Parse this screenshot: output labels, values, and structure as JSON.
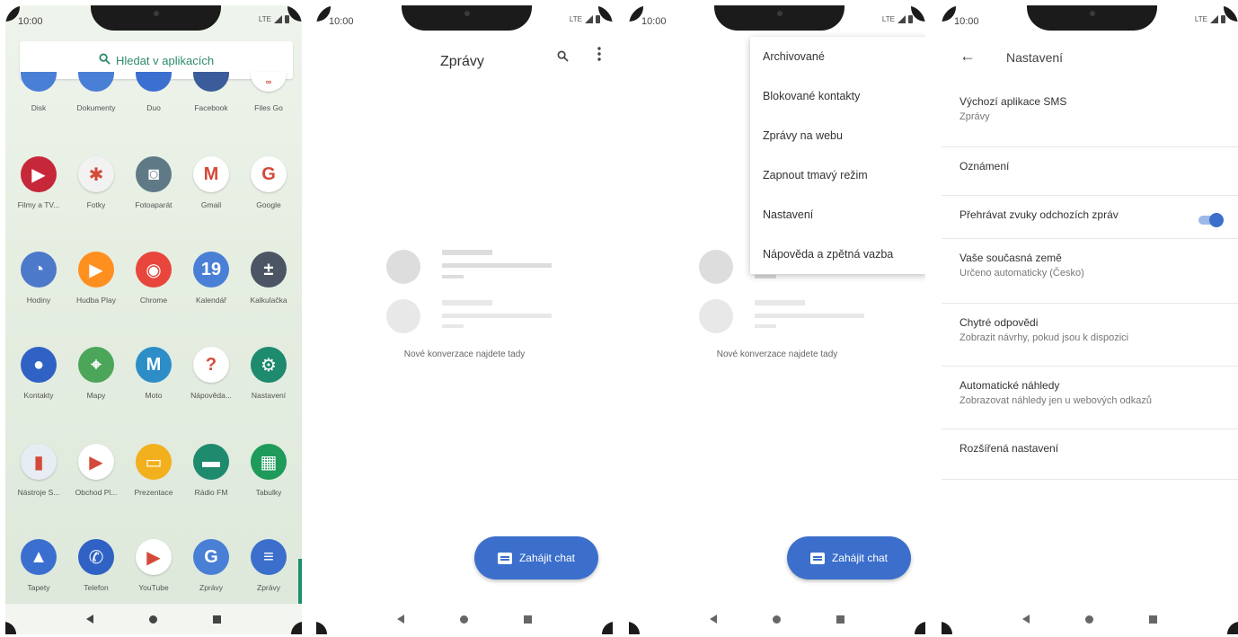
{
  "status": {
    "time": "10:00",
    "network": "LTE"
  },
  "drawer": {
    "search_label": "Hledat v aplikacích",
    "rows": [
      [
        {
          "label": "Disk",
          "color": "#4a7fd6",
          "glyph": ""
        },
        {
          "label": "Dokumenty",
          "color": "#4a7fd6",
          "glyph": ""
        },
        {
          "label": "Duo",
          "color": "#3b6fd0",
          "glyph": ""
        },
        {
          "label": "Facebook",
          "color": "#3b5c9a",
          "glyph": ""
        },
        {
          "label": "Files Go",
          "color": "#ffffff",
          "glyph": "∞"
        }
      ],
      [
        {
          "label": "Filmy a TV...",
          "color": "#c62839",
          "glyph": "▶"
        },
        {
          "label": "Fotky",
          "color": "#f2f2f2",
          "glyph": "✱"
        },
        {
          "label": "Fotoaparát",
          "color": "#5f7a86",
          "glyph": "◙"
        },
        {
          "label": "Gmail",
          "color": "#ffffff",
          "glyph": "M"
        },
        {
          "label": "Google",
          "color": "#ffffff",
          "glyph": "G"
        }
      ],
      [
        {
          "label": "Hodiny",
          "color": "#4c79c9",
          "glyph": "◔"
        },
        {
          "label": "Hudba Play",
          "color": "#ff8f1f",
          "glyph": "▶"
        },
        {
          "label": "Chrome",
          "color": "#e8453c",
          "glyph": "◉"
        },
        {
          "label": "Kalendář",
          "color": "#4a7fd6",
          "glyph": "19"
        },
        {
          "label": "Kalkulačka",
          "color": "#4b5563",
          "glyph": "±"
        }
      ],
      [
        {
          "label": "Kontakty",
          "color": "#2f62c4",
          "glyph": "●"
        },
        {
          "label": "Mapy",
          "color": "#4ca65a",
          "glyph": "⌖"
        },
        {
          "label": "Moto",
          "color": "#2d8ec7",
          "glyph": "M"
        },
        {
          "label": "Nápověda...",
          "color": "#ffffff",
          "glyph": "?"
        },
        {
          "label": "Nastavení",
          "color": "#1e8a6e",
          "glyph": "⚙"
        }
      ],
      [
        {
          "label": "Nástroje S...",
          "color": "#e8ecf3",
          "glyph": "▮"
        },
        {
          "label": "Obchod Pl...",
          "color": "#ffffff",
          "glyph": "▶"
        },
        {
          "label": "Prezentace",
          "color": "#f2b01e",
          "glyph": "▭"
        },
        {
          "label": "Rádio FM",
          "color": "#1e8a6e",
          "glyph": "▬"
        },
        {
          "label": "Tabulky",
          "color": "#1e9a5a",
          "glyph": "▦"
        }
      ],
      [
        {
          "label": "Tapety",
          "color": "#3a6fd0",
          "glyph": "▲"
        },
        {
          "label": "Telefon",
          "color": "#2f62c4",
          "glyph": "✆"
        },
        {
          "label": "YouTube",
          "color": "#ffffff",
          "glyph": "▶"
        },
        {
          "label": "Zprávy",
          "color": "#4a7fd6",
          "glyph": "G"
        },
        {
          "label": "Zprávy",
          "color": "#3c6fcc",
          "glyph": "≡"
        }
      ]
    ]
  },
  "messages": {
    "title": "Zprávy",
    "empty_text": "Nové konverzace najdete tady",
    "fab_label": "Zahájit chat"
  },
  "overflow_menu": {
    "items": [
      "Archivované",
      "Blokované kontakty",
      "Zprávy na webu",
      "Zapnout tmavý režim",
      "Nastavení",
      "Nápověda a zpětná vazba"
    ]
  },
  "settings": {
    "title": "Nastavení",
    "items": [
      {
        "title": "Výchozí aplikace SMS",
        "subtitle": "Zprávy"
      },
      {
        "title": "Oznámení",
        "subtitle": ""
      },
      {
        "title": "Přehrávat zvuky odchozích zpráv",
        "subtitle": "",
        "toggle": true
      },
      {
        "title": "Vaše současná země",
        "subtitle": "Určeno automaticky (Česko)"
      },
      {
        "title": "Chytré odpovědi",
        "subtitle": "Zobrazit návrhy, pokud jsou k dispozici"
      },
      {
        "title": "Automatické náhledy",
        "subtitle": "Zobrazovat náhledy jen u webových odkazů"
      },
      {
        "title": "Rozšířená nastavení",
        "subtitle": ""
      }
    ]
  }
}
